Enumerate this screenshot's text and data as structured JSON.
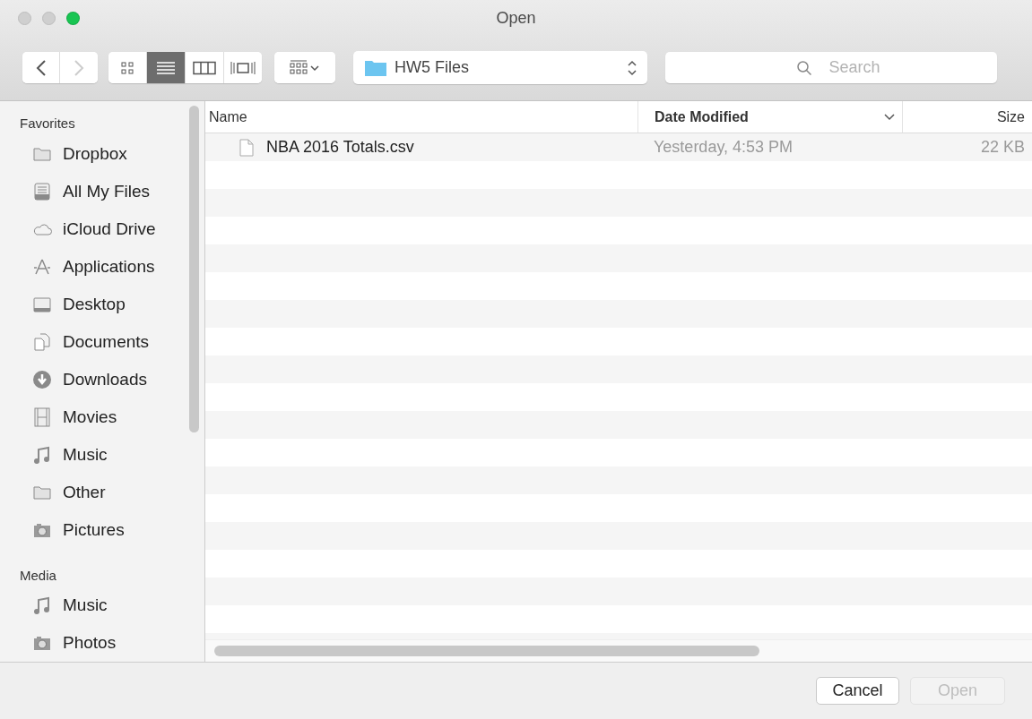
{
  "window": {
    "title": "Open",
    "controls": [
      {
        "kind": "close",
        "active": false
      },
      {
        "kind": "minimize",
        "active": false
      },
      {
        "kind": "zoom",
        "active": true
      }
    ]
  },
  "toolbar": {
    "back": {
      "disabled": false
    },
    "forward": {
      "disabled": true
    },
    "view_modes": [
      {
        "kind": "icons",
        "selected": false
      },
      {
        "kind": "list",
        "selected": true
      },
      {
        "kind": "columns",
        "selected": false
      },
      {
        "kind": "coverflow",
        "selected": false
      }
    ],
    "location": {
      "label": "HW5 Files"
    },
    "search": {
      "placeholder": "Search"
    }
  },
  "sidebar": {
    "sections": [
      {
        "title": "Favorites",
        "items": [
          {
            "label": "Dropbox",
            "kind": "folder"
          },
          {
            "label": "All My Files",
            "kind": "files"
          },
          {
            "label": "iCloud Drive",
            "kind": "cloud"
          },
          {
            "label": "Applications",
            "kind": "apps"
          },
          {
            "label": "Desktop",
            "kind": "desktop"
          },
          {
            "label": "Documents",
            "kind": "documents"
          },
          {
            "label": "Downloads",
            "kind": "downloads"
          },
          {
            "label": "Movies",
            "kind": "movies"
          },
          {
            "label": "Music",
            "kind": "music"
          },
          {
            "label": "Other",
            "kind": "folder"
          },
          {
            "label": "Pictures",
            "kind": "camera"
          }
        ]
      },
      {
        "title": "Media",
        "items": [
          {
            "label": "Music",
            "kind": "music"
          },
          {
            "label": "Photos",
            "kind": "camera"
          }
        ]
      }
    ]
  },
  "table": {
    "columns": [
      {
        "label": "Name",
        "sorted": false
      },
      {
        "label": "Date Modified",
        "sorted": true
      },
      {
        "label": "Size",
        "sorted": false
      }
    ],
    "rows": [
      {
        "name": "NBA 2016 Totals.csv",
        "date": "Yesterday, 4:53 PM",
        "size": "22 KB"
      }
    ]
  },
  "buttons": [
    {
      "label": "Cancel",
      "disabled": false
    },
    {
      "label": "Open",
      "disabled": true
    }
  ]
}
